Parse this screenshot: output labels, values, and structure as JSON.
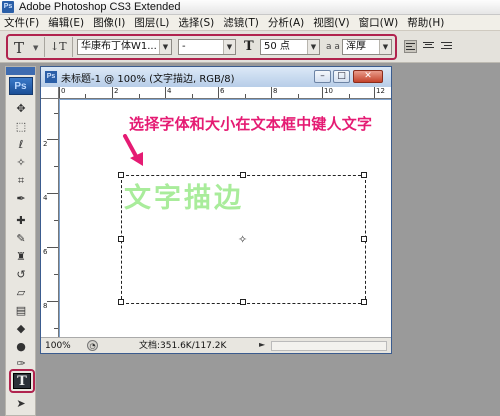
{
  "app": {
    "title": "Adobe Photoshop CS3 Extended",
    "logo_text": "Ps"
  },
  "menu": {
    "items": [
      "文件(F)",
      "编辑(E)",
      "图像(I)",
      "图层(L)",
      "选择(S)",
      "滤镜(T)",
      "分析(A)",
      "视图(V)",
      "窗口(W)",
      "帮助(H)"
    ]
  },
  "options": {
    "tool_preset_glyph": "T",
    "orientation_glyph": "↓T",
    "font_family": "华康布丁体W1...",
    "font_style": "-",
    "size_icon": "T",
    "font_size": "50 点",
    "antialias_icon": "a a",
    "antialias": "浑厚"
  },
  "toolbox": {
    "logo": "Ps",
    "tools": [
      {
        "name": "move-tool",
        "glyph": "✥"
      },
      {
        "name": "marquee-tool",
        "glyph": "⬚"
      },
      {
        "name": "lasso-tool",
        "glyph": "ℓ"
      },
      {
        "name": "magic-wand-tool",
        "glyph": "✧"
      },
      {
        "name": "crop-tool",
        "glyph": "⌗"
      },
      {
        "name": "eyedropper-tool",
        "glyph": "✒"
      },
      {
        "name": "healing-brush-tool",
        "glyph": "✚"
      },
      {
        "name": "brush-tool",
        "glyph": "✎"
      },
      {
        "name": "clone-stamp-tool",
        "glyph": "♜"
      },
      {
        "name": "history-brush-tool",
        "glyph": "↺"
      },
      {
        "name": "eraser-tool",
        "glyph": "▱"
      },
      {
        "name": "gradient-tool",
        "glyph": "▤"
      },
      {
        "name": "blur-tool",
        "glyph": "◆"
      },
      {
        "name": "dodge-tool",
        "glyph": "●"
      },
      {
        "name": "pen-tool",
        "glyph": "✑"
      }
    ],
    "text_tool": "T",
    "path_select_glyph": "➤"
  },
  "document": {
    "title": "未标题-1 @ 100% (文字描边, RGB/8)",
    "icon": "Ps",
    "minimize": "–",
    "maximize": "□",
    "close": "✕",
    "ruler_top_labels": [
      "0",
      "2",
      "4",
      "6",
      "8",
      "10",
      "12"
    ],
    "ruler_left_labels": [
      "2",
      "4",
      "6",
      "8"
    ],
    "annotation": "选择字体和大小在文本框中键人文字",
    "sample_text": "文字描边",
    "center_mark": "✧"
  },
  "status": {
    "zoom": "100%",
    "doc_info": "文档:351.6K/117.2K",
    "arrow": "►"
  },
  "colors": {
    "highlight_border": "#b0234e",
    "annotation": "#e51b73",
    "sample_text": "#a9ec9b"
  }
}
